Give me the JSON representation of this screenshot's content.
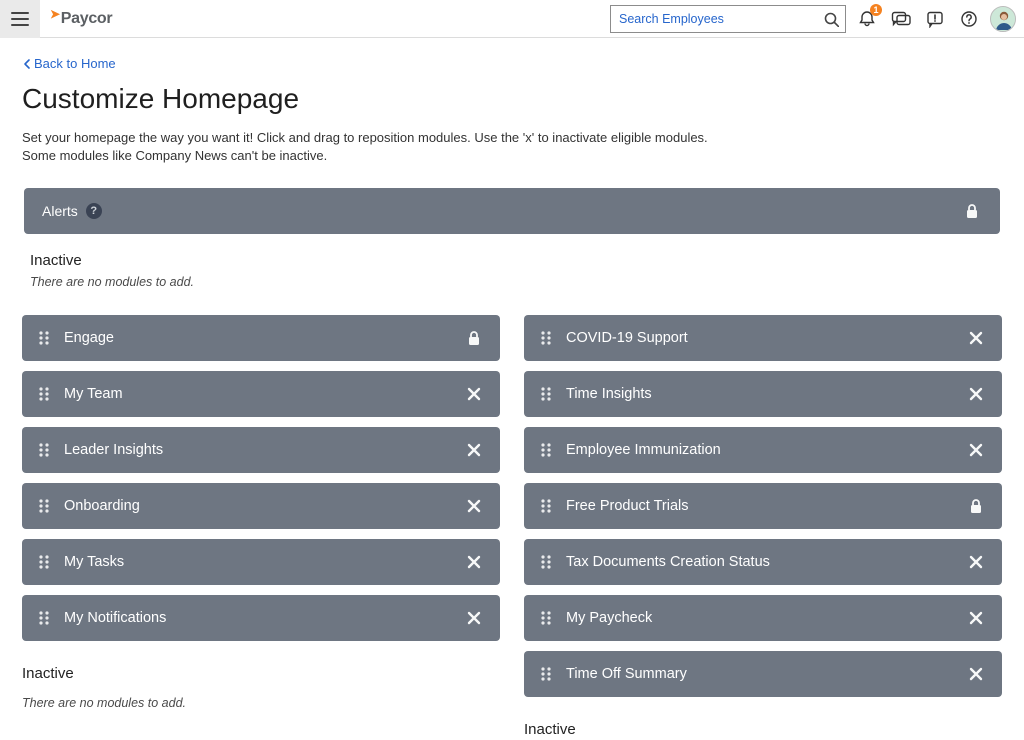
{
  "header": {
    "brand": "Paycor",
    "search_placeholder": "Search Employees",
    "notification_count": "1"
  },
  "page": {
    "back_link": "Back to Home",
    "title": "Customize Homepage",
    "intro_line1": "Set your homepage the way you want it! Click and drag to reposition modules. Use the 'x' to inactivate eligible modules.",
    "intro_line2": "Some modules like Company News can't be inactive."
  },
  "alerts_module": {
    "label": "Alerts",
    "locked": true
  },
  "alerts_inactive": {
    "title": "Inactive",
    "empty": "There are no modules to add."
  },
  "columns": {
    "left": [
      {
        "label": "Engage",
        "action": "lock"
      },
      {
        "label": "My Team",
        "action": "close"
      },
      {
        "label": "Leader Insights",
        "action": "close"
      },
      {
        "label": "Onboarding",
        "action": "close"
      },
      {
        "label": "My Tasks",
        "action": "close"
      },
      {
        "label": "My Notifications",
        "action": "close"
      }
    ],
    "right": [
      {
        "label": "COVID-19 Support",
        "action": "close"
      },
      {
        "label": "Time Insights",
        "action": "close"
      },
      {
        "label": "Employee Immunization",
        "action": "close"
      },
      {
        "label": "Free Product Trials",
        "action": "lock"
      },
      {
        "label": "Tax Documents Creation Status",
        "action": "close"
      },
      {
        "label": "My Paycheck",
        "action": "close"
      },
      {
        "label": "Time Off Summary",
        "action": "close"
      }
    ]
  },
  "col_inactive": {
    "title": "Inactive",
    "empty": "There are no modules to add."
  }
}
